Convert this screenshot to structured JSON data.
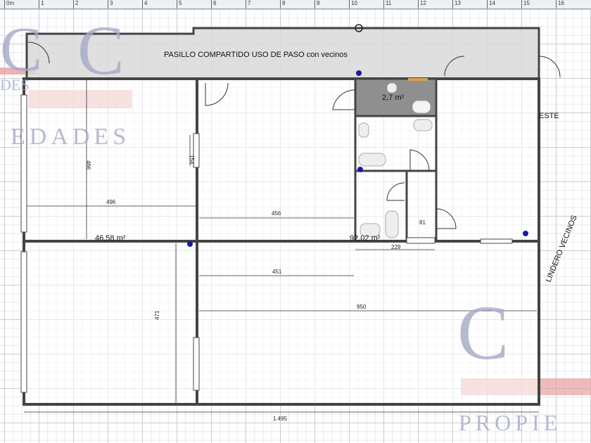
{
  "ruler": {
    "labels": [
      "0m",
      "1",
      "2",
      "3",
      "4",
      "5",
      "6",
      "7",
      "8",
      "9",
      "10",
      "11",
      "12",
      "13",
      "14",
      "15",
      "16"
    ]
  },
  "plan": {
    "corridor_label": "PASILLO COMPARTIDO USO DE PASO con vecinos",
    "bathroom_area": "2,7 m²",
    "orientation": "ESTE",
    "boundary_label": "LINDERO VECINOS",
    "area_left": "46,58 m²",
    "area_main": "92,02 m²",
    "dimensions": {
      "d466": "466",
      "d496": "496",
      "d154": "154",
      "d456": "456",
      "d81": "81",
      "d229": "229",
      "d451": "451",
      "d950": "950",
      "d471": "471",
      "d1495": "1.495"
    }
  },
  "watermark": {
    "letter1": "C",
    "letter2": "C",
    "letter3": "C",
    "text1": "DES",
    "text2": "EDADES",
    "text3": "PROPIE"
  },
  "colors": {
    "wall": "#444444",
    "corridor": "#d9d9d9",
    "bathroom": "#8f8f8f",
    "marker": "#1a1aa8",
    "watermark_red": "#e8a0a0"
  }
}
